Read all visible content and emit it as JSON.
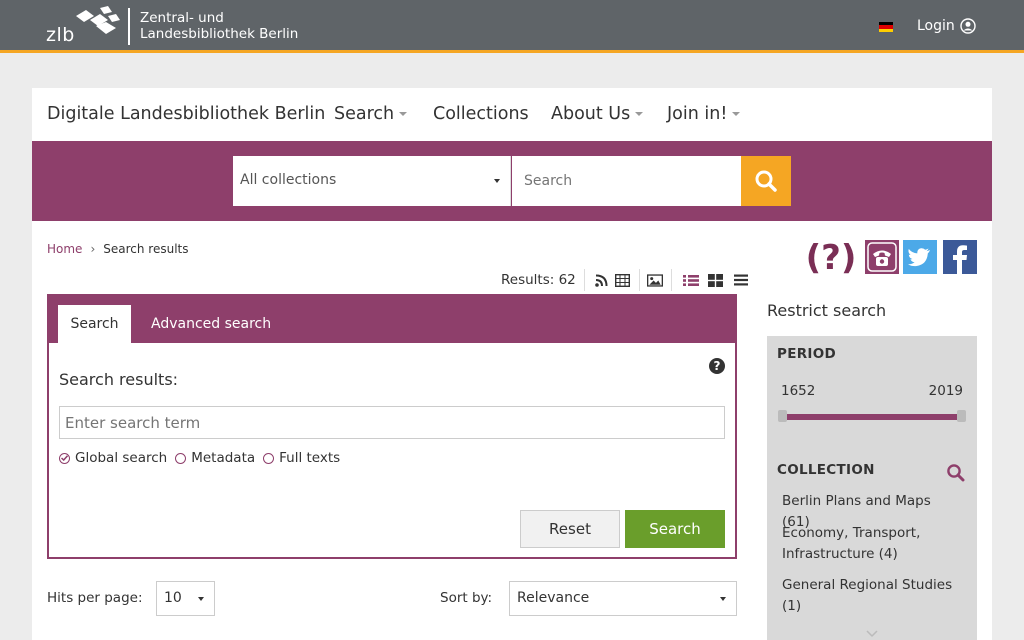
{
  "topbar": {
    "logo_short": "zlb",
    "logo_name_line1": "Zentral- und",
    "logo_name_line2": "Landesbibliothek Berlin",
    "login_label": "Login"
  },
  "navbar": {
    "brand": "Digitale Landesbibliothek Berlin",
    "items": [
      {
        "label": "Search",
        "has_caret": true
      },
      {
        "label": "Collections",
        "has_caret": false
      },
      {
        "label": "About Us",
        "has_caret": true
      },
      {
        "label": "Join in!",
        "has_caret": true
      }
    ]
  },
  "searchbar": {
    "collection_selected": "All collections",
    "placeholder": "Search"
  },
  "breadcrumb": {
    "home": "Home",
    "separator": "›",
    "current": "Search results"
  },
  "results": {
    "label": "Results: 62"
  },
  "panel": {
    "tab_search": "Search",
    "tab_advanced": "Advanced search",
    "help": "?",
    "label": "Search results:",
    "input_placeholder": "Enter search term",
    "radio_global": "Global search",
    "radio_metadata": "Metadata",
    "radio_fulltexts": "Full texts",
    "reset_label": "Reset",
    "search_label": "Search"
  },
  "controls": {
    "hits_label": "Hits per page:",
    "hits_value": "10",
    "sort_label": "Sort by:",
    "sort_value": "Relevance"
  },
  "sidebar": {
    "title": "Restrict search",
    "period_heading": "PERIOD",
    "period_from": "1652",
    "period_to": "2019",
    "collection_heading": "COLLECTION",
    "collections": [
      {
        "line1": "Berlin Plans and Maps (61)"
      },
      {
        "line1": "Economy, Transport,",
        "line2": "Infrastructure (4)"
      },
      {
        "line1": "General Regional Studies",
        "line2": "(1)"
      }
    ]
  },
  "colors": {
    "brand_purple": "#8e3f6b",
    "accent_orange": "#f5a623",
    "search_green": "#6a9e2b",
    "topbar_gray": "#5f6468"
  }
}
